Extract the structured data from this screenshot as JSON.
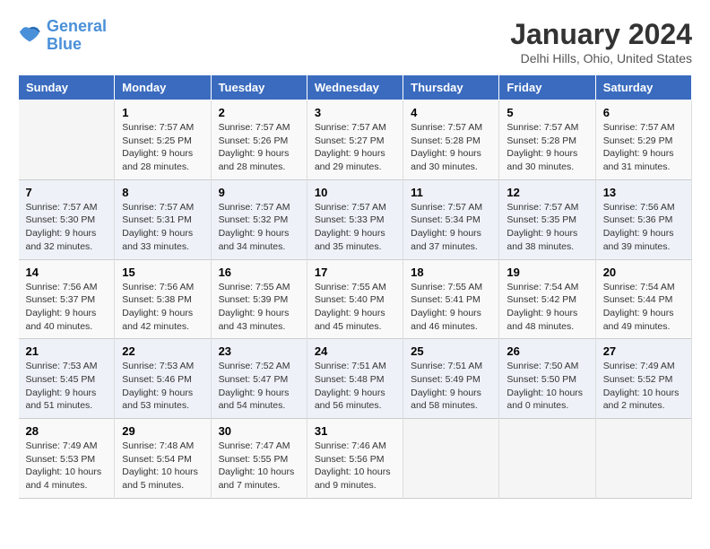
{
  "logo": {
    "line1": "General",
    "line2": "Blue"
  },
  "title": "January 2024",
  "subtitle": "Delhi Hills, Ohio, United States",
  "header_days": [
    "Sunday",
    "Monday",
    "Tuesday",
    "Wednesday",
    "Thursday",
    "Friday",
    "Saturday"
  ],
  "weeks": [
    [
      {
        "day": "",
        "info": ""
      },
      {
        "day": "1",
        "info": "Sunrise: 7:57 AM\nSunset: 5:25 PM\nDaylight: 9 hours\nand 28 minutes."
      },
      {
        "day": "2",
        "info": "Sunrise: 7:57 AM\nSunset: 5:26 PM\nDaylight: 9 hours\nand 28 minutes."
      },
      {
        "day": "3",
        "info": "Sunrise: 7:57 AM\nSunset: 5:27 PM\nDaylight: 9 hours\nand 29 minutes."
      },
      {
        "day": "4",
        "info": "Sunrise: 7:57 AM\nSunset: 5:28 PM\nDaylight: 9 hours\nand 30 minutes."
      },
      {
        "day": "5",
        "info": "Sunrise: 7:57 AM\nSunset: 5:28 PM\nDaylight: 9 hours\nand 30 minutes."
      },
      {
        "day": "6",
        "info": "Sunrise: 7:57 AM\nSunset: 5:29 PM\nDaylight: 9 hours\nand 31 minutes."
      }
    ],
    [
      {
        "day": "7",
        "info": "Sunrise: 7:57 AM\nSunset: 5:30 PM\nDaylight: 9 hours\nand 32 minutes."
      },
      {
        "day": "8",
        "info": "Sunrise: 7:57 AM\nSunset: 5:31 PM\nDaylight: 9 hours\nand 33 minutes."
      },
      {
        "day": "9",
        "info": "Sunrise: 7:57 AM\nSunset: 5:32 PM\nDaylight: 9 hours\nand 34 minutes."
      },
      {
        "day": "10",
        "info": "Sunrise: 7:57 AM\nSunset: 5:33 PM\nDaylight: 9 hours\nand 35 minutes."
      },
      {
        "day": "11",
        "info": "Sunrise: 7:57 AM\nSunset: 5:34 PM\nDaylight: 9 hours\nand 37 minutes."
      },
      {
        "day": "12",
        "info": "Sunrise: 7:57 AM\nSunset: 5:35 PM\nDaylight: 9 hours\nand 38 minutes."
      },
      {
        "day": "13",
        "info": "Sunrise: 7:56 AM\nSunset: 5:36 PM\nDaylight: 9 hours\nand 39 minutes."
      }
    ],
    [
      {
        "day": "14",
        "info": "Sunrise: 7:56 AM\nSunset: 5:37 PM\nDaylight: 9 hours\nand 40 minutes."
      },
      {
        "day": "15",
        "info": "Sunrise: 7:56 AM\nSunset: 5:38 PM\nDaylight: 9 hours\nand 42 minutes."
      },
      {
        "day": "16",
        "info": "Sunrise: 7:55 AM\nSunset: 5:39 PM\nDaylight: 9 hours\nand 43 minutes."
      },
      {
        "day": "17",
        "info": "Sunrise: 7:55 AM\nSunset: 5:40 PM\nDaylight: 9 hours\nand 45 minutes."
      },
      {
        "day": "18",
        "info": "Sunrise: 7:55 AM\nSunset: 5:41 PM\nDaylight: 9 hours\nand 46 minutes."
      },
      {
        "day": "19",
        "info": "Sunrise: 7:54 AM\nSunset: 5:42 PM\nDaylight: 9 hours\nand 48 minutes."
      },
      {
        "day": "20",
        "info": "Sunrise: 7:54 AM\nSunset: 5:44 PM\nDaylight: 9 hours\nand 49 minutes."
      }
    ],
    [
      {
        "day": "21",
        "info": "Sunrise: 7:53 AM\nSunset: 5:45 PM\nDaylight: 9 hours\nand 51 minutes."
      },
      {
        "day": "22",
        "info": "Sunrise: 7:53 AM\nSunset: 5:46 PM\nDaylight: 9 hours\nand 53 minutes."
      },
      {
        "day": "23",
        "info": "Sunrise: 7:52 AM\nSunset: 5:47 PM\nDaylight: 9 hours\nand 54 minutes."
      },
      {
        "day": "24",
        "info": "Sunrise: 7:51 AM\nSunset: 5:48 PM\nDaylight: 9 hours\nand 56 minutes."
      },
      {
        "day": "25",
        "info": "Sunrise: 7:51 AM\nSunset: 5:49 PM\nDaylight: 9 hours\nand 58 minutes."
      },
      {
        "day": "26",
        "info": "Sunrise: 7:50 AM\nSunset: 5:50 PM\nDaylight: 10 hours\nand 0 minutes."
      },
      {
        "day": "27",
        "info": "Sunrise: 7:49 AM\nSunset: 5:52 PM\nDaylight: 10 hours\nand 2 minutes."
      }
    ],
    [
      {
        "day": "28",
        "info": "Sunrise: 7:49 AM\nSunset: 5:53 PM\nDaylight: 10 hours\nand 4 minutes."
      },
      {
        "day": "29",
        "info": "Sunrise: 7:48 AM\nSunset: 5:54 PM\nDaylight: 10 hours\nand 5 minutes."
      },
      {
        "day": "30",
        "info": "Sunrise: 7:47 AM\nSunset: 5:55 PM\nDaylight: 10 hours\nand 7 minutes."
      },
      {
        "day": "31",
        "info": "Sunrise: 7:46 AM\nSunset: 5:56 PM\nDaylight: 10 hours\nand 9 minutes."
      },
      {
        "day": "",
        "info": ""
      },
      {
        "day": "",
        "info": ""
      },
      {
        "day": "",
        "info": ""
      }
    ]
  ]
}
